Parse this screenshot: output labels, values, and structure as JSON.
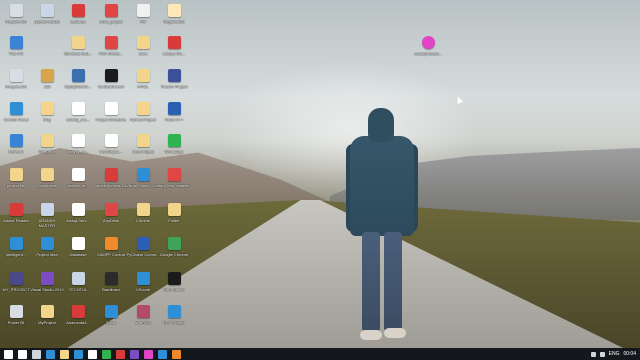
{
  "desktop_icons": [
    {
      "label": "Recycle Bin",
      "color": "#d7dde3",
      "col": 0,
      "row": 0
    },
    {
      "label": "project-related",
      "color": "#c9d6e8",
      "col": 1,
      "row": 0
    },
    {
      "label": "Lectures",
      "color": "#d93a3a",
      "col": 2,
      "row": 0
    },
    {
      "label": "word_project",
      "color": "#e04646",
      "col": 3,
      "row": 0
    },
    {
      "label": "Pdf",
      "color": "#f0f0f0",
      "col": 4,
      "row": 0
    },
    {
      "label": "Registration",
      "color": "#ffe9b8",
      "col": 5,
      "row": 0
    },
    {
      "label": "This PC",
      "color": "#3b83d6",
      "col": 0,
      "row": 1
    },
    {
      "label": "Windows Sub...",
      "color": "#f2d58a",
      "col": 2,
      "row": 1
    },
    {
      "label": "PDF-Relate...",
      "color": "#e04646",
      "col": 3,
      "row": 1
    },
    {
      "label": "Java",
      "color": "#f2d58a",
      "col": 4,
      "row": 1
    },
    {
      "label": "Library Fin...",
      "color": "#d93a3a",
      "col": 5,
      "row": 1
    },
    {
      "label": "Recycle Bin",
      "color": "#d7dde3",
      "col": 0,
      "row": 2
    },
    {
      "label": "123",
      "color": "#d8a64a",
      "col": 1,
      "row": 2
    },
    {
      "label": "MySqlWebCl...",
      "color": "#3a6fb0",
      "col": 2,
      "row": 2
    },
    {
      "label": "CarDashboard",
      "color": "#1b1b1b",
      "col": 3,
      "row": 2
    },
    {
      "label": "HTML",
      "color": "#f2d58a",
      "col": 4,
      "row": 2
    },
    {
      "label": "Tracker Project",
      "color": "#3b4f9a",
      "col": 5,
      "row": 2
    },
    {
      "label": "Control Panel",
      "color": "#2f8fd6",
      "col": 0,
      "row": 3
    },
    {
      "label": "blog",
      "color": "#f2d58a",
      "col": 1,
      "row": 3
    },
    {
      "label": "activity_ma...",
      "color": "#ffffff",
      "col": 2,
      "row": 3
    },
    {
      "label": "Project Schedule",
      "color": "#ffffff",
      "col": 3,
      "row": 3
    },
    {
      "label": "Python Project",
      "color": "#f2d58a",
      "col": 4,
      "row": 3
    },
    {
      "label": "Turbo C++",
      "color": "#2b5fb4",
      "col": 5,
      "row": 3
    },
    {
      "label": "Network",
      "color": "#3b83d6",
      "col": 0,
      "row": 4
    },
    {
      "label": "OneDrive",
      "color": "#f2d58a",
      "col": 1,
      "row": 4
    },
    {
      "label": "activity_m...",
      "color": "#ffffff",
      "col": 2,
      "row": 4
    },
    {
      "label": "PanSlaptic...",
      "color": "#ffffff",
      "col": 3,
      "row": 4
    },
    {
      "label": "Java Project",
      "color": "#f2d58a",
      "col": 4,
      "row": 4
    },
    {
      "label": "WhatsApp",
      "color": "#2fb350",
      "col": 5,
      "row": 4
    },
    {
      "label": "project file",
      "color": "#f2d58a",
      "col": 0,
      "row": 5
    },
    {
      "label": "Downloads",
      "color": "#f2d58a",
      "col": 1,
      "row": 5
    },
    {
      "label": "activity_m...",
      "color": "#ffffff",
      "col": 2,
      "row": 5
    },
    {
      "label": "Adobe Acrobat DC",
      "color": "#d93a3a",
      "col": 3,
      "row": 5
    },
    {
      "label": "Visual Studio Code",
      "color": "#2f8fd6",
      "col": 4,
      "row": 5
    },
    {
      "label": "AnyDesk Installer",
      "color": "#e04646",
      "col": 5,
      "row": 5
    },
    {
      "label": "Adobe Reader",
      "color": "#d93a3a",
      "col": 0,
      "row": 6
    },
    {
      "label": "ARANSH MASTER",
      "color": "#c9d6e8",
      "col": 1,
      "row": 6
    },
    {
      "label": "Mssql-Serv...",
      "color": "#ffffff",
      "col": 2,
      "row": 6
    },
    {
      "label": "AnyDesk",
      "color": "#e04646",
      "col": 3,
      "row": 6
    },
    {
      "label": "Chrome",
      "color": "#f2d58a",
      "col": 4,
      "row": 6
    },
    {
      "label": "Folder",
      "color": "#f2d58a",
      "col": 5,
      "row": 6
    },
    {
      "label": "Intelligent...",
      "color": "#2f8fd6",
      "col": 0,
      "row": 7
    },
    {
      "label": "Project Idea",
      "color": "#2f8fd6",
      "col": 1,
      "row": 7
    },
    {
      "label": "Database",
      "color": "#ffffff",
      "col": 2,
      "row": 7
    },
    {
      "label": "XAMPP Control",
      "color": "#f08a2c",
      "col": 3,
      "row": 7
    },
    {
      "label": "PyCharm Comm...",
      "color": "#2b5fb4",
      "col": 4,
      "row": 7
    },
    {
      "label": "Google Chrome",
      "color": "#3fa35a",
      "col": 5,
      "row": 7
    },
    {
      "label": "MY_PROJECT",
      "color": "#4a4a8a",
      "col": 0,
      "row": 8
    },
    {
      "label": "Visual Studio 2019",
      "color": "#7b4cc4",
      "col": 1,
      "row": 8
    },
    {
      "label": "TECHTUL",
      "color": "#c9d6e8",
      "col": 2,
      "row": 8
    },
    {
      "label": "Bandicam",
      "color": "#2b2b2b",
      "col": 3,
      "row": 8
    },
    {
      "label": "VScode",
      "color": "#2f8fd6",
      "col": 4,
      "row": 8
    },
    {
      "label": "OBS Studio",
      "color": "#1b1b1b",
      "col": 5,
      "row": 8
    },
    {
      "label": "Power BI",
      "color": "#d7dde3",
      "col": 0,
      "row": 9
    },
    {
      "label": "MyProject",
      "color": "#f2d58a",
      "col": 1,
      "row": 9
    },
    {
      "label": "Anaconda3...",
      "color": "#d93a3a",
      "col": 2,
      "row": 9
    },
    {
      "label": "Zoom",
      "color": "#2f8fd6",
      "col": 3,
      "row": 9
    },
    {
      "label": "WinRAR",
      "color": "#b34a6a",
      "col": 4,
      "row": 9
    },
    {
      "label": "PHP Project",
      "color": "#2f8fd6",
      "col": 5,
      "row": 9
    }
  ],
  "extra_icon": {
    "label": "uccasprocess...",
    "color": "#e045c8"
  },
  "taskbar": {
    "icons": [
      {
        "name": "start",
        "color": "#ffffff"
      },
      {
        "name": "search",
        "color": "#ffffff"
      },
      {
        "name": "task-view",
        "color": "#cfd6dc"
      },
      {
        "name": "app1",
        "color": "#2f8fd6"
      },
      {
        "name": "app2",
        "color": "#f2d58a"
      },
      {
        "name": "app3",
        "color": "#2f8fd6"
      },
      {
        "name": "app4",
        "color": "#ffffff"
      },
      {
        "name": "app5",
        "color": "#2fb350"
      },
      {
        "name": "app6",
        "color": "#d93a3a"
      },
      {
        "name": "app7",
        "color": "#7b4cc4"
      },
      {
        "name": "app8",
        "color": "#e045c8"
      },
      {
        "name": "app9",
        "color": "#2f8fd6"
      },
      {
        "name": "app10",
        "color": "#f08a2c"
      }
    ],
    "language": "ENG",
    "time": "00:04"
  }
}
